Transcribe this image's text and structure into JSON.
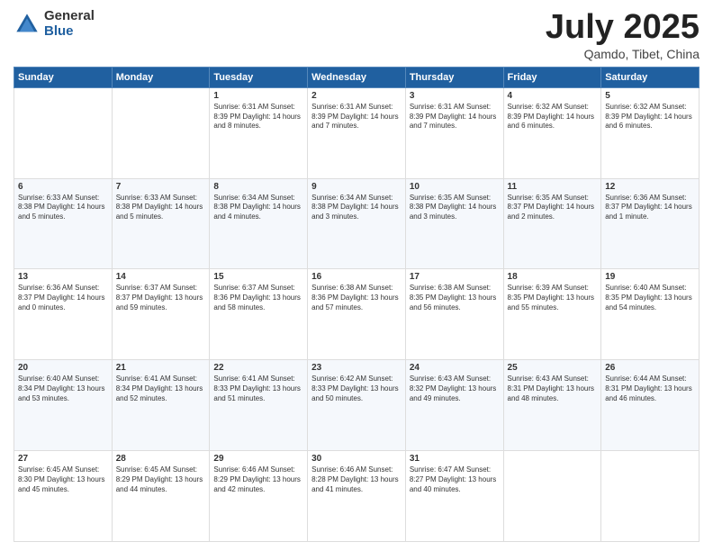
{
  "header": {
    "logo_general": "General",
    "logo_blue": "Blue",
    "title": "July 2025",
    "location": "Qamdo, Tibet, China"
  },
  "days_of_week": [
    "Sunday",
    "Monday",
    "Tuesday",
    "Wednesday",
    "Thursday",
    "Friday",
    "Saturday"
  ],
  "weeks": [
    [
      {
        "day": "",
        "info": ""
      },
      {
        "day": "",
        "info": ""
      },
      {
        "day": "1",
        "info": "Sunrise: 6:31 AM\nSunset: 8:39 PM\nDaylight: 14 hours and 8 minutes."
      },
      {
        "day": "2",
        "info": "Sunrise: 6:31 AM\nSunset: 8:39 PM\nDaylight: 14 hours and 7 minutes."
      },
      {
        "day": "3",
        "info": "Sunrise: 6:31 AM\nSunset: 8:39 PM\nDaylight: 14 hours and 7 minutes."
      },
      {
        "day": "4",
        "info": "Sunrise: 6:32 AM\nSunset: 8:39 PM\nDaylight: 14 hours and 6 minutes."
      },
      {
        "day": "5",
        "info": "Sunrise: 6:32 AM\nSunset: 8:39 PM\nDaylight: 14 hours and 6 minutes."
      }
    ],
    [
      {
        "day": "6",
        "info": "Sunrise: 6:33 AM\nSunset: 8:38 PM\nDaylight: 14 hours and 5 minutes."
      },
      {
        "day": "7",
        "info": "Sunrise: 6:33 AM\nSunset: 8:38 PM\nDaylight: 14 hours and 5 minutes."
      },
      {
        "day": "8",
        "info": "Sunrise: 6:34 AM\nSunset: 8:38 PM\nDaylight: 14 hours and 4 minutes."
      },
      {
        "day": "9",
        "info": "Sunrise: 6:34 AM\nSunset: 8:38 PM\nDaylight: 14 hours and 3 minutes."
      },
      {
        "day": "10",
        "info": "Sunrise: 6:35 AM\nSunset: 8:38 PM\nDaylight: 14 hours and 3 minutes."
      },
      {
        "day": "11",
        "info": "Sunrise: 6:35 AM\nSunset: 8:37 PM\nDaylight: 14 hours and 2 minutes."
      },
      {
        "day": "12",
        "info": "Sunrise: 6:36 AM\nSunset: 8:37 PM\nDaylight: 14 hours and 1 minute."
      }
    ],
    [
      {
        "day": "13",
        "info": "Sunrise: 6:36 AM\nSunset: 8:37 PM\nDaylight: 14 hours and 0 minutes."
      },
      {
        "day": "14",
        "info": "Sunrise: 6:37 AM\nSunset: 8:37 PM\nDaylight: 13 hours and 59 minutes."
      },
      {
        "day": "15",
        "info": "Sunrise: 6:37 AM\nSunset: 8:36 PM\nDaylight: 13 hours and 58 minutes."
      },
      {
        "day": "16",
        "info": "Sunrise: 6:38 AM\nSunset: 8:36 PM\nDaylight: 13 hours and 57 minutes."
      },
      {
        "day": "17",
        "info": "Sunrise: 6:38 AM\nSunset: 8:35 PM\nDaylight: 13 hours and 56 minutes."
      },
      {
        "day": "18",
        "info": "Sunrise: 6:39 AM\nSunset: 8:35 PM\nDaylight: 13 hours and 55 minutes."
      },
      {
        "day": "19",
        "info": "Sunrise: 6:40 AM\nSunset: 8:35 PM\nDaylight: 13 hours and 54 minutes."
      }
    ],
    [
      {
        "day": "20",
        "info": "Sunrise: 6:40 AM\nSunset: 8:34 PM\nDaylight: 13 hours and 53 minutes."
      },
      {
        "day": "21",
        "info": "Sunrise: 6:41 AM\nSunset: 8:34 PM\nDaylight: 13 hours and 52 minutes."
      },
      {
        "day": "22",
        "info": "Sunrise: 6:41 AM\nSunset: 8:33 PM\nDaylight: 13 hours and 51 minutes."
      },
      {
        "day": "23",
        "info": "Sunrise: 6:42 AM\nSunset: 8:33 PM\nDaylight: 13 hours and 50 minutes."
      },
      {
        "day": "24",
        "info": "Sunrise: 6:43 AM\nSunset: 8:32 PM\nDaylight: 13 hours and 49 minutes."
      },
      {
        "day": "25",
        "info": "Sunrise: 6:43 AM\nSunset: 8:31 PM\nDaylight: 13 hours and 48 minutes."
      },
      {
        "day": "26",
        "info": "Sunrise: 6:44 AM\nSunset: 8:31 PM\nDaylight: 13 hours and 46 minutes."
      }
    ],
    [
      {
        "day": "27",
        "info": "Sunrise: 6:45 AM\nSunset: 8:30 PM\nDaylight: 13 hours and 45 minutes."
      },
      {
        "day": "28",
        "info": "Sunrise: 6:45 AM\nSunset: 8:29 PM\nDaylight: 13 hours and 44 minutes."
      },
      {
        "day": "29",
        "info": "Sunrise: 6:46 AM\nSunset: 8:29 PM\nDaylight: 13 hours and 42 minutes."
      },
      {
        "day": "30",
        "info": "Sunrise: 6:46 AM\nSunset: 8:28 PM\nDaylight: 13 hours and 41 minutes."
      },
      {
        "day": "31",
        "info": "Sunrise: 6:47 AM\nSunset: 8:27 PM\nDaylight: 13 hours and 40 minutes."
      },
      {
        "day": "",
        "info": ""
      },
      {
        "day": "",
        "info": ""
      }
    ]
  ]
}
